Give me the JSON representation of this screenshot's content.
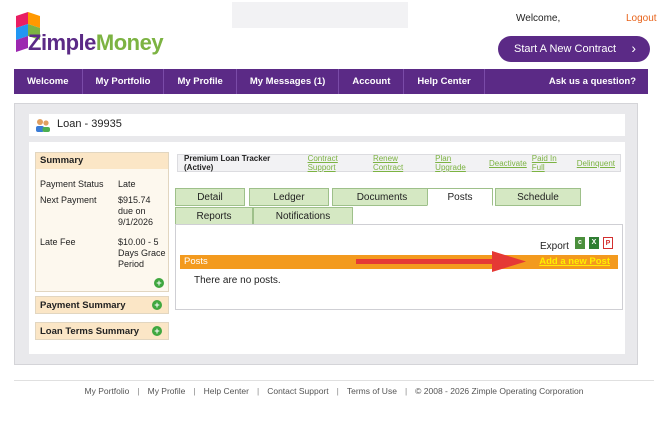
{
  "header": {
    "logo_zimple": "Zimple",
    "logo_money": "Money",
    "welcome": "Welcome,",
    "logout": "Logout",
    "start_contract": "Start A New Contract"
  },
  "nav": {
    "items": [
      "Welcome",
      "My Portfolio",
      "My Profile",
      "My Messages (1)",
      "Account",
      "Help Center"
    ],
    "ask": "Ask us a question?"
  },
  "loan": {
    "title": "Loan - 39935"
  },
  "summary": {
    "heading": "Summary",
    "payment_status_label": "Payment Status",
    "payment_status_value": "Late",
    "next_payment_label": "Next Payment",
    "next_payment_value": "$915.74 due on 9/1/2026",
    "late_fee_label": "Late Fee",
    "late_fee_value": "$10.00 - 5 Days Grace Period"
  },
  "side_boxes": {
    "payment_summary": "Payment Summary",
    "loan_terms_summary": "Loan Terms Summary"
  },
  "tracker": {
    "title": "Premium Loan Tracker (Active)",
    "links": [
      "Contract Support",
      "Renew Contract",
      "Plan Upgrade",
      "Deactivate",
      "Paid In Full",
      "Delinquent"
    ]
  },
  "tabs": {
    "detail": "Detail",
    "ledger": "Ledger",
    "documents": "Documents",
    "posts": "Posts",
    "schedule": "Schedule",
    "reports": "Reports",
    "notifications": "Notifications"
  },
  "posts_panel": {
    "export": "Export",
    "heading": "Posts",
    "add_link": "Add a new Post",
    "empty": "There are no posts."
  },
  "footer": {
    "links": [
      "My Portfolio",
      "My Profile",
      "Help Center",
      "Contact Support",
      "Terms of Use"
    ],
    "copyright": "© 2008 - 2026 Zimple Operating Corporation"
  },
  "colors": {
    "brand_purple": "#5b2a86",
    "brand_green": "#7cb342",
    "accent_orange": "#f39a1e",
    "logout_orange": "#e8631a"
  }
}
